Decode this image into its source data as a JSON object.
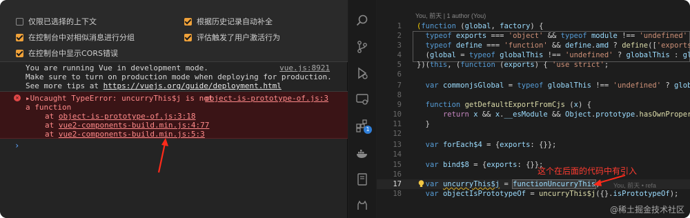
{
  "settings": {
    "options": [
      {
        "label": "仅限已选择的上下文",
        "checked": false
      },
      {
        "label": "根据历史记录自动补全",
        "checked": true
      },
      {
        "label": "在控制台中对相似消息进行分组",
        "checked": true
      },
      {
        "label": "评估触发了用户激活行为",
        "checked": true
      },
      {
        "label": "在控制台中显示CORS错误",
        "checked": true
      }
    ]
  },
  "console": {
    "info": {
      "line1": "You are running Vue in development mode.",
      "source": "vue.js:8921",
      "line2": "Make sure to turn on production mode when deploying for production.",
      "line3_prefix": "See more tips at ",
      "line3_link": "https://vuejs.org/guide/deployment.html"
    },
    "error": {
      "icon": "x-circle-icon",
      "caret": "▸",
      "message_a": "Uncaught TypeError: uncurryThis$j is not",
      "source": "object-is-prototype-of.js:3",
      "message_b": "a function",
      "stack": [
        {
          "prefix": "at ",
          "link": "object-is-prototype-of.js:3:18"
        },
        {
          "prefix": "at ",
          "link": "vue2-components-build.min.js:4:77"
        },
        {
          "prefix": "at ",
          "link": "vue2-components-build.min.js:5:3"
        }
      ]
    },
    "prompt": "›"
  },
  "activity_bar": {
    "icons": [
      "search-icon",
      "source-control-icon",
      "run-debug-icon",
      "remote-explorer-icon",
      "extensions-icon",
      "docker-icon",
      "notebook-icon",
      "github-icon"
    ],
    "extensions_badge": "1"
  },
  "editor": {
    "blame_header": "You, 前天 | 1 author (You)",
    "inline_blame": "You, 前天 • refa",
    "annotation": "这个在后面的代码中有引入",
    "watermark": "@稀土掘金技术社区",
    "line_numbers": [
      "1",
      "2",
      "3",
      "4",
      "5",
      "6",
      "7",
      "8",
      "9",
      "10",
      "11",
      "12",
      "13",
      "14",
      "15",
      "16",
      "17",
      "18"
    ],
    "current_line": "17"
  },
  "colors": {
    "accent": "#f0a23a",
    "error_bg": "#3a1416",
    "annotation": "#ff3b30"
  }
}
